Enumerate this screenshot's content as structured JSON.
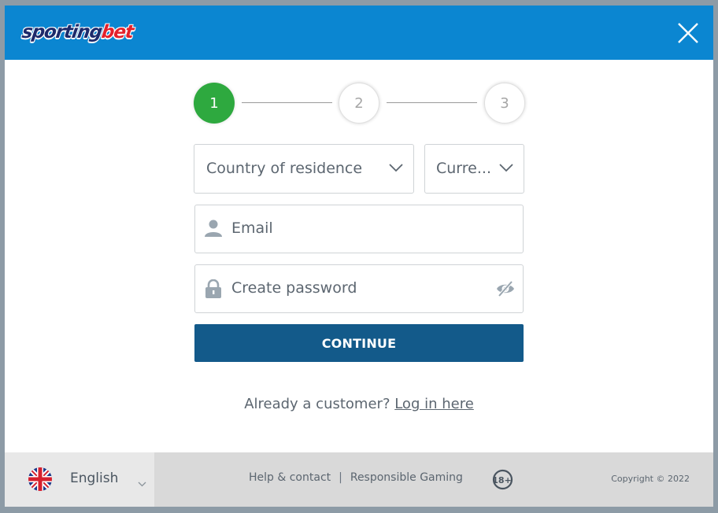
{
  "header": {
    "brand_part1": "sporting",
    "brand_part2": "bet",
    "close_icon": "close-icon"
  },
  "stepper": {
    "steps": [
      {
        "label": "1",
        "state": "active"
      },
      {
        "label": "2",
        "state": "todo"
      },
      {
        "label": "3",
        "state": "todo"
      }
    ]
  },
  "form": {
    "country_select": {
      "placeholder": "Country of residence",
      "icon": "chevron-down-icon"
    },
    "currency_select": {
      "placeholder": "Curre...",
      "icon": "chevron-down-icon"
    },
    "email": {
      "placeholder": "Email",
      "icon": "user-icon"
    },
    "password": {
      "placeholder": "Create password",
      "icon": "lock-icon",
      "toggle_icon": "eye-slash-icon"
    },
    "continue_label": "CONTINUE",
    "already_text": "Already a customer? ",
    "login_link": "Log in here"
  },
  "footer": {
    "language": {
      "label": "English",
      "flag": "uk-flag-icon"
    },
    "links": [
      "Help & contact",
      "Responsible Gaming"
    ],
    "separator": "|",
    "age_badge": "18+",
    "copyright": "Copyright © 2022"
  },
  "colors": {
    "header_bg": "#0b86d1",
    "step_active": "#2ea93f",
    "button_bg": "#135a8a",
    "footer_bg": "#d9d9d9"
  }
}
